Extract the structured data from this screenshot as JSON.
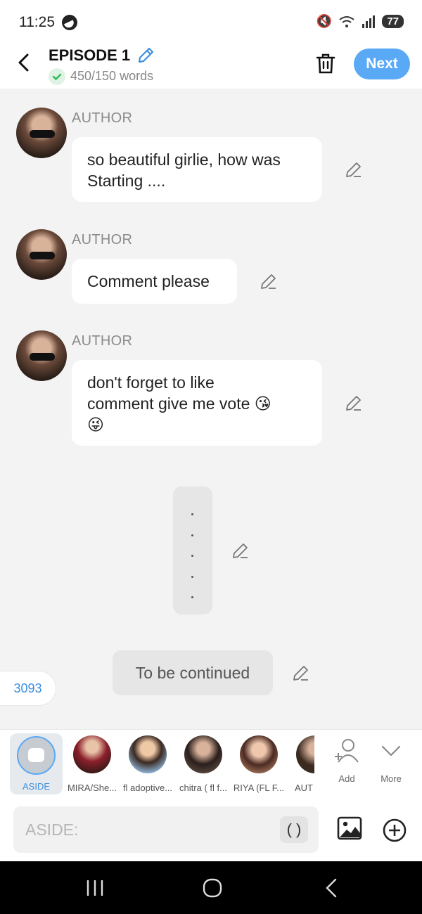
{
  "status_bar": {
    "time": "11:25",
    "battery": "77"
  },
  "header": {
    "title": "EPISODE 1",
    "word_count": "450/150 words",
    "next_label": "Next"
  },
  "messages": [
    {
      "author": "AUTHOR",
      "lines": [
        "so beautiful girlie, how was",
        "Starting ...."
      ]
    },
    {
      "author": "AUTHOR",
      "lines": [
        "Comment please"
      ]
    },
    {
      "author": "AUTHOR",
      "lines": [
        "don't forget to like",
        "comment give me vote 😘",
        "😜"
      ]
    }
  ],
  "to_be_continued": "To be continued",
  "count_badge": "3093",
  "characters": [
    {
      "name": "ASIDE"
    },
    {
      "name": "MIRA/She..."
    },
    {
      "name": "fl adoptive..."
    },
    {
      "name": "chitra ( fl f..."
    },
    {
      "name": "RIYA (FL F..."
    },
    {
      "name": "AUT"
    }
  ],
  "bar_actions": {
    "add": "Add",
    "more": "More"
  },
  "input": {
    "placeholder": "ASIDE:",
    "paren": "( )"
  },
  "colors": {
    "accent": "#5aa9f5",
    "bg": "#f3f3f3",
    "bubble": "#ffffff"
  }
}
